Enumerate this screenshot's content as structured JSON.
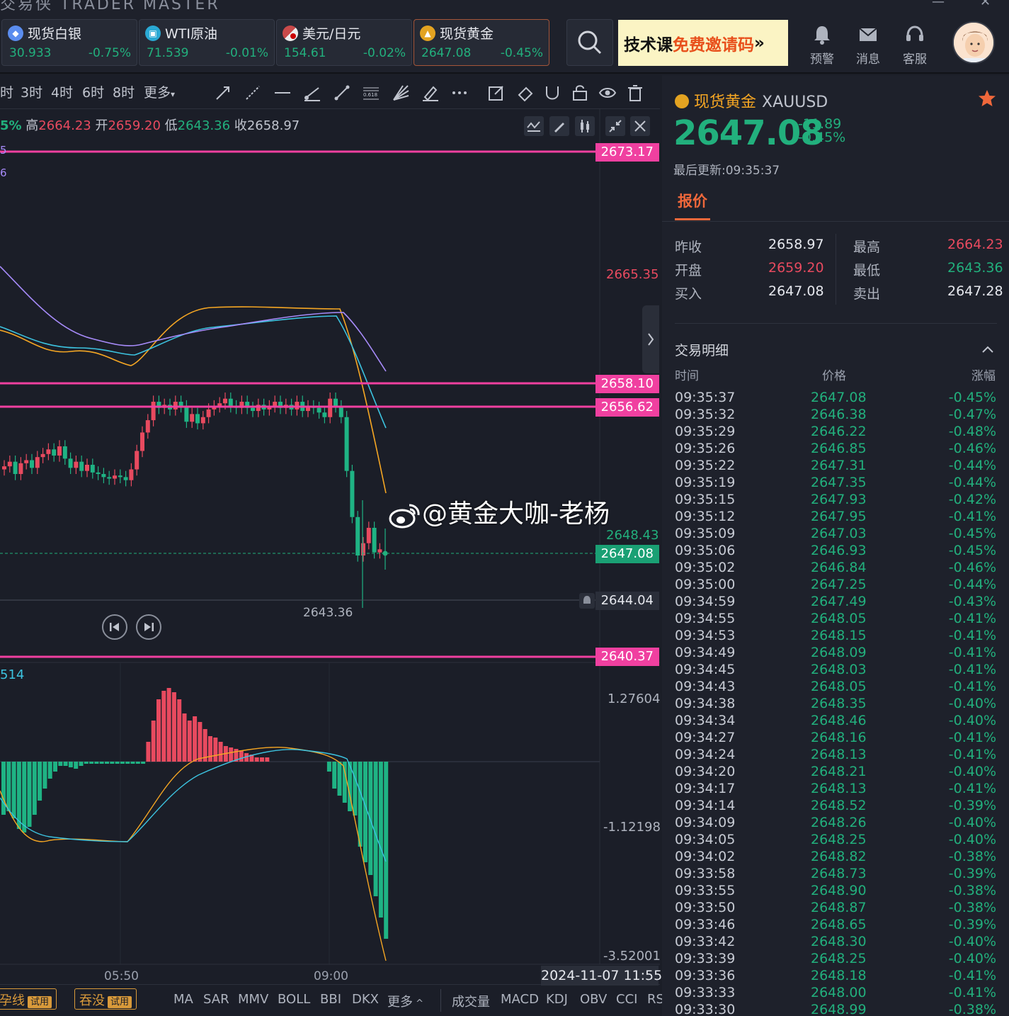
{
  "app": {
    "title": "交易侠 TRADER MASTER"
  },
  "quotes": [
    {
      "name": "现货白银",
      "price": "30.933",
      "change": "-0.75%",
      "icon": "silver-coin-icon",
      "color": "#5b8def"
    },
    {
      "name": "WTI原油",
      "price": "71.539",
      "change": "-0.01%",
      "icon": "oil-barrel-icon",
      "color": "#2aa9d4"
    },
    {
      "name": "美元/日元",
      "price": "154.61",
      "change": "-0.02%",
      "icon": "us-flag-icon",
      "color": "#c94a4a"
    },
    {
      "name": "现货黄金",
      "price": "2647.08",
      "change": "-0.45%",
      "icon": "gold-coin-icon",
      "color": "#e3a321"
    }
  ],
  "promo": {
    "part1": "技术课",
    "part2": "免费邀请码",
    "arrow": "»"
  },
  "header_icons": [
    {
      "label": "预警",
      "icon": "bell-icon"
    },
    {
      "label": "消息",
      "icon": "mail-icon"
    },
    {
      "label": "客服",
      "icon": "headset-icon"
    }
  ],
  "timeframes": [
    "时",
    "3时",
    "4时",
    "6时",
    "8时",
    "更多"
  ],
  "ohlc": {
    "pct": "5%",
    "high_label": "高",
    "high": "2664.23",
    "open_label": "开",
    "open": "2659.20",
    "low_label": "低",
    "low": "2643.36",
    "close_label": "收",
    "close": "2658.97"
  },
  "price_levels": {
    "l1": "2673.17",
    "l2": "2665.35",
    "l3": "2658.10",
    "l4": "2656.62",
    "l5": "2648.43",
    "l6": "2647.08",
    "l7": "2644.04",
    "l8": "2640.37",
    "low_mark": "2643.36"
  },
  "macd": {
    "label": "514",
    "t1": "1.27604",
    "t2": "-1.12198",
    "t3": "-3.52001"
  },
  "xaxis": {
    "t1": "05:50",
    "t2": "09:00",
    "date": "2024-11-07 11:55"
  },
  "watermark": "@黄金大咖-老杨",
  "bottom": {
    "try1": "孕线",
    "try2": "吞没",
    "try_tag": "试用",
    "indicators": [
      "MA",
      "SAR",
      "MMV",
      "BOLL",
      "BBI",
      "DKX",
      "更多"
    ],
    "indicators2": [
      "成交量",
      "MACD",
      "KDJ",
      "OBV",
      "CCI",
      "RS"
    ]
  },
  "panel": {
    "name": "现货黄金",
    "symbol": "XAUUSD",
    "price": "2647.08",
    "chg": "-11.89",
    "chg_pct": "-0.45%",
    "updated": "最后更新:09:35:37",
    "tab": "报价",
    "q": {
      "prev_label": "昨收",
      "prev": "2658.97",
      "high_label": "最高",
      "high": "2664.23",
      "open_label": "开盘",
      "open": "2659.20",
      "low_label": "最低",
      "low": "2643.36",
      "bid_label": "买入",
      "bid": "2647.08",
      "ask_label": "卖出",
      "ask": "2647.28"
    },
    "details_title": "交易明细",
    "cols": {
      "time": "时间",
      "price": "价格",
      "chg": "涨幅"
    },
    "trades": [
      [
        "09:35:37",
        "2647.08",
        "-0.45%"
      ],
      [
        "09:35:32",
        "2646.38",
        "-0.47%"
      ],
      [
        "09:35:29",
        "2646.22",
        "-0.48%"
      ],
      [
        "09:35:26",
        "2646.85",
        "-0.46%"
      ],
      [
        "09:35:22",
        "2647.31",
        "-0.44%"
      ],
      [
        "09:35:19",
        "2647.35",
        "-0.44%"
      ],
      [
        "09:35:15",
        "2647.93",
        "-0.42%"
      ],
      [
        "09:35:12",
        "2647.95",
        "-0.41%"
      ],
      [
        "09:35:09",
        "2647.03",
        "-0.45%"
      ],
      [
        "09:35:06",
        "2646.93",
        "-0.45%"
      ],
      [
        "09:35:02",
        "2646.84",
        "-0.46%"
      ],
      [
        "09:35:00",
        "2647.25",
        "-0.44%"
      ],
      [
        "09:34:59",
        "2647.49",
        "-0.43%"
      ],
      [
        "09:34:55",
        "2648.05",
        "-0.41%"
      ],
      [
        "09:34:53",
        "2648.15",
        "-0.41%"
      ],
      [
        "09:34:49",
        "2648.09",
        "-0.41%"
      ],
      [
        "09:34:45",
        "2648.03",
        "-0.41%"
      ],
      [
        "09:34:43",
        "2648.05",
        "-0.41%"
      ],
      [
        "09:34:38",
        "2648.35",
        "-0.40%"
      ],
      [
        "09:34:34",
        "2648.46",
        "-0.40%"
      ],
      [
        "09:34:27",
        "2648.16",
        "-0.41%"
      ],
      [
        "09:34:24",
        "2648.13",
        "-0.41%"
      ],
      [
        "09:34:20",
        "2648.21",
        "-0.40%"
      ],
      [
        "09:34:17",
        "2648.13",
        "-0.41%"
      ],
      [
        "09:34:14",
        "2648.52",
        "-0.39%"
      ],
      [
        "09:34:09",
        "2648.26",
        "-0.40%"
      ],
      [
        "09:34:05",
        "2648.25",
        "-0.40%"
      ],
      [
        "09:34:02",
        "2648.82",
        "-0.38%"
      ],
      [
        "09:33:58",
        "2648.73",
        "-0.39%"
      ],
      [
        "09:33:55",
        "2648.90",
        "-0.38%"
      ],
      [
        "09:33:50",
        "2648.87",
        "-0.38%"
      ],
      [
        "09:33:46",
        "2648.65",
        "-0.39%"
      ],
      [
        "09:33:42",
        "2648.30",
        "-0.40%"
      ],
      [
        "09:33:39",
        "2648.25",
        "-0.40%"
      ],
      [
        "09:33:36",
        "2648.18",
        "-0.41%"
      ],
      [
        "09:33:33",
        "2648.00",
        "-0.41%"
      ],
      [
        "09:33:30",
        "2648.99",
        "-0.38%"
      ]
    ]
  }
}
